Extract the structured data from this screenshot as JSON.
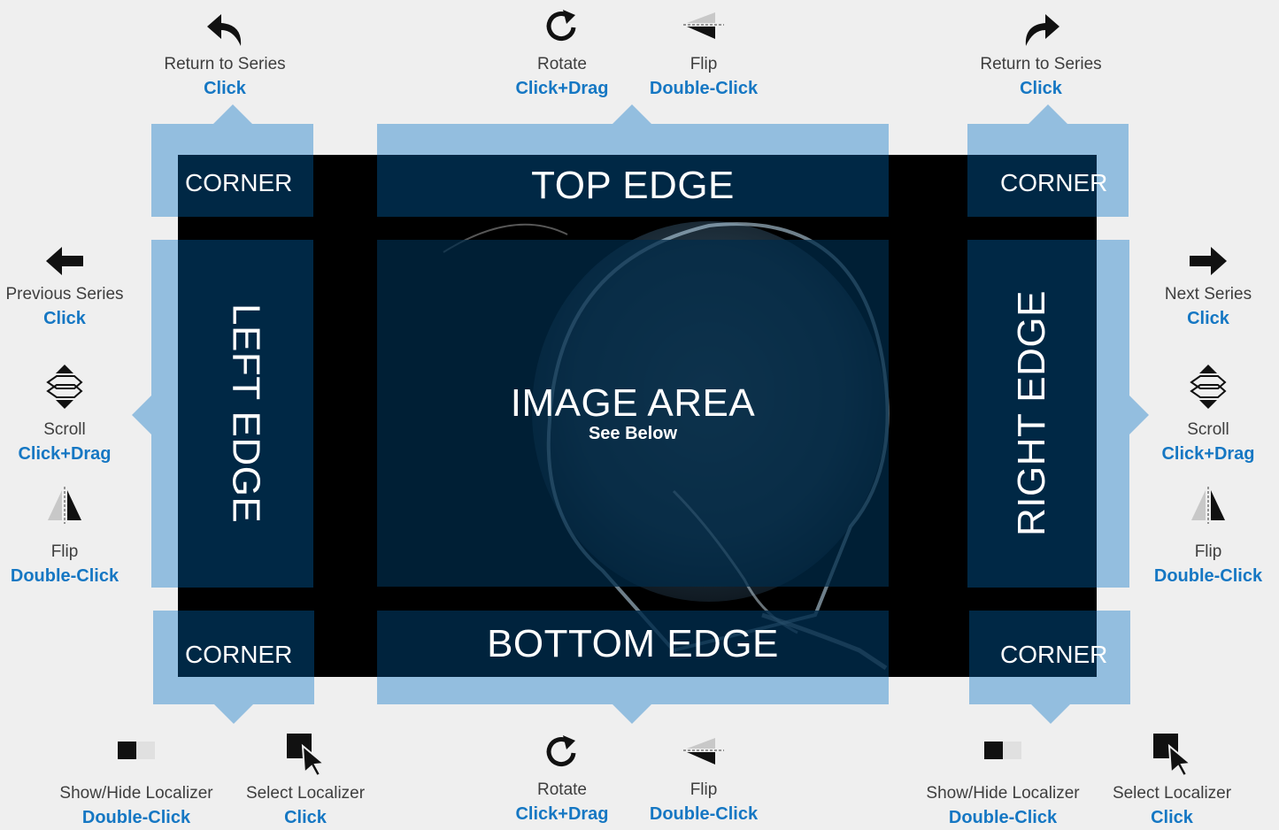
{
  "zones": {
    "corner_label": "CORNER",
    "top_edge": "TOP EDGE",
    "bottom_edge": "BOTTOM EDGE",
    "left_edge": "LEFT EDGE",
    "right_edge": "RIGHT EDGE",
    "image_area": "IMAGE AREA",
    "image_area_sub": "See Below"
  },
  "top_left": {
    "title": "Return to Series",
    "action": "Click",
    "icon": "return-left-icon"
  },
  "top_right": {
    "title": "Return to Series",
    "action": "Click",
    "icon": "return-right-icon"
  },
  "top_center": [
    {
      "title": "Rotate",
      "action": "Click+Drag",
      "icon": "rotate-icon"
    },
    {
      "title": "Flip",
      "action": "Double-Click",
      "icon": "flip-vertical-icon"
    }
  ],
  "left": [
    {
      "title": "Previous Series",
      "action": "Click",
      "icon": "arrow-left-icon"
    },
    {
      "title": "Scroll",
      "action": "Click+Drag",
      "icon": "scroll-icon"
    },
    {
      "title": "Flip",
      "action": "Double-Click",
      "icon": "flip-horizontal-icon"
    }
  ],
  "right": [
    {
      "title": "Next Series",
      "action": "Click",
      "icon": "arrow-right-icon"
    },
    {
      "title": "Scroll",
      "action": "Click+Drag",
      "icon": "scroll-icon"
    },
    {
      "title": "Flip",
      "action": "Double-Click",
      "icon": "flip-horizontal-icon"
    }
  ],
  "bottom_left": [
    {
      "title": "Show/Hide Localizer",
      "action": "Double-Click",
      "icon": "localizer-toggle-icon"
    },
    {
      "title": "Select Localizer",
      "action": "Click",
      "icon": "select-cursor-icon"
    }
  ],
  "bottom_center": [
    {
      "title": "Rotate",
      "action": "Click+Drag",
      "icon": "rotate-icon"
    },
    {
      "title": "Flip",
      "action": "Double-Click",
      "icon": "flip-vertical-icon"
    }
  ],
  "bottom_right": [
    {
      "title": "Show/Hide Localizer",
      "action": "Double-Click",
      "icon": "localizer-toggle-icon"
    },
    {
      "title": "Select Localizer",
      "action": "Click",
      "icon": "select-cursor-icon"
    }
  ],
  "colors": {
    "frame": "#93bedf",
    "zone": "#002b4a",
    "action_text": "#1577c3",
    "label_text": "#3e3e3e"
  }
}
